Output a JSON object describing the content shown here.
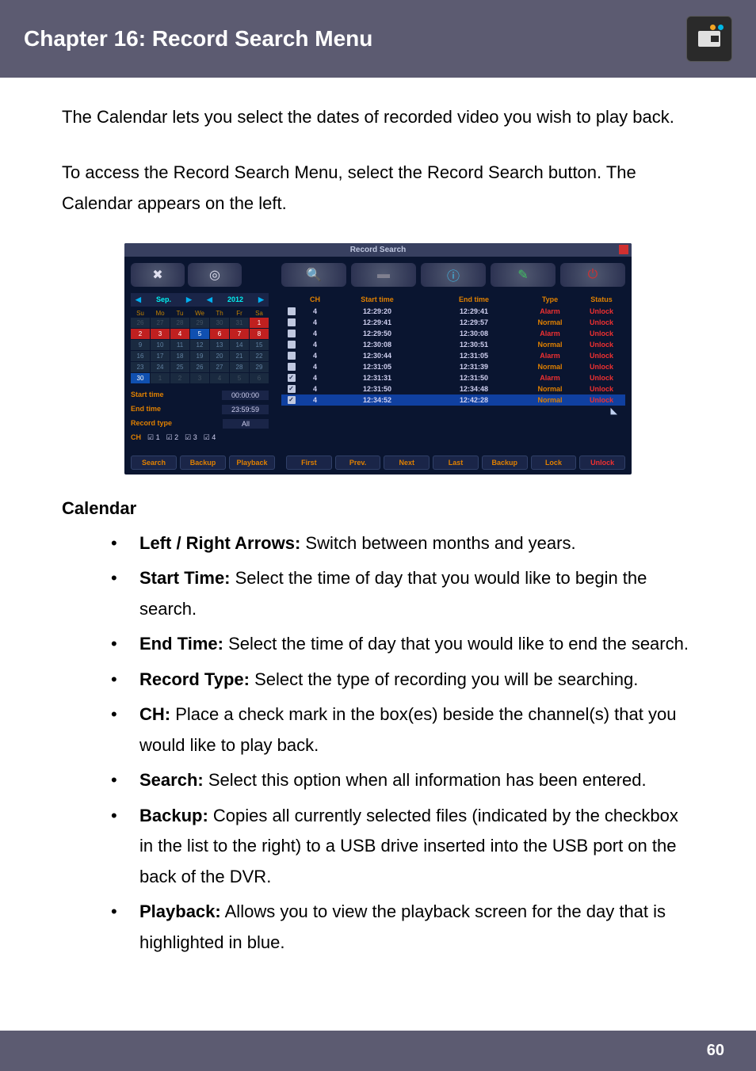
{
  "header": {
    "title": "Chapter 16: Record Search Menu"
  },
  "intro": {
    "p1": "The Calendar lets you select the dates of recorded video you wish to play back.",
    "p2": "To access the Record Search Menu, select the Record Search button. The Calendar appears on the left."
  },
  "screenshot": {
    "title": "Record Search",
    "month_row": {
      "month": "Sep.",
      "year": "2012"
    },
    "dow": [
      "Su",
      "Mo",
      "Tu",
      "We",
      "Th",
      "Fr",
      "Sa"
    ],
    "calendar_weeks": [
      [
        {
          "d": "26",
          "c": "dim"
        },
        {
          "d": "27",
          "c": "dim"
        },
        {
          "d": "28",
          "c": "dim"
        },
        {
          "d": "29",
          "c": "dim"
        },
        {
          "d": "30",
          "c": "dim"
        },
        {
          "d": "31",
          "c": "dim"
        },
        {
          "d": "1",
          "c": "red"
        }
      ],
      [
        {
          "d": "2",
          "c": "red"
        },
        {
          "d": "3",
          "c": "red"
        },
        {
          "d": "4",
          "c": "red"
        },
        {
          "d": "5",
          "c": "blue"
        },
        {
          "d": "6",
          "c": "red"
        },
        {
          "d": "7",
          "c": "red"
        },
        {
          "d": "8",
          "c": "red"
        }
      ],
      [
        {
          "d": "9",
          "c": ""
        },
        {
          "d": "10",
          "c": ""
        },
        {
          "d": "11",
          "c": ""
        },
        {
          "d": "12",
          "c": ""
        },
        {
          "d": "13",
          "c": ""
        },
        {
          "d": "14",
          "c": ""
        },
        {
          "d": "15",
          "c": ""
        }
      ],
      [
        {
          "d": "16",
          "c": ""
        },
        {
          "d": "17",
          "c": ""
        },
        {
          "d": "18",
          "c": ""
        },
        {
          "d": "19",
          "c": ""
        },
        {
          "d": "20",
          "c": ""
        },
        {
          "d": "21",
          "c": ""
        },
        {
          "d": "22",
          "c": ""
        }
      ],
      [
        {
          "d": "23",
          "c": ""
        },
        {
          "d": "24",
          "c": ""
        },
        {
          "d": "25",
          "c": ""
        },
        {
          "d": "26",
          "c": ""
        },
        {
          "d": "27",
          "c": ""
        },
        {
          "d": "28",
          "c": ""
        },
        {
          "d": "29",
          "c": ""
        }
      ],
      [
        {
          "d": "30",
          "c": "blue"
        },
        {
          "d": "1",
          "c": "dim"
        },
        {
          "d": "2",
          "c": "dim"
        },
        {
          "d": "3",
          "c": "dim"
        },
        {
          "d": "4",
          "c": "dim"
        },
        {
          "d": "5",
          "c": "dim"
        },
        {
          "d": "6",
          "c": "dim"
        }
      ]
    ],
    "fields": {
      "start_time_label": "Start time",
      "start_time_value": "00:00:00",
      "end_time_label": "End time",
      "end_time_value": "23:59:59",
      "record_type_label": "Record type",
      "record_type_value": "All",
      "ch_label": "CH",
      "ch_values": [
        "☑ 1",
        "☑ 2",
        "☑ 3",
        "☑ 4"
      ]
    },
    "table": {
      "headers": [
        "",
        "CH",
        "Start time",
        "End time",
        "Type",
        "Status"
      ],
      "rows": [
        {
          "cb": "☐",
          "ch": "4",
          "start": "12:29:20",
          "end": "12:29:41",
          "type": "Alarm",
          "type_class": "type-alarm",
          "status": "Unlock"
        },
        {
          "cb": "☐",
          "ch": "4",
          "start": "12:29:41",
          "end": "12:29:57",
          "type": "Normal",
          "type_class": "type-normal",
          "status": "Unlock"
        },
        {
          "cb": "☐",
          "ch": "4",
          "start": "12:29:50",
          "end": "12:30:08",
          "type": "Alarm",
          "type_class": "type-alarm",
          "status": "Unlock"
        },
        {
          "cb": "☐",
          "ch": "4",
          "start": "12:30:08",
          "end": "12:30:51",
          "type": "Normal",
          "type_class": "type-normal",
          "status": "Unlock"
        },
        {
          "cb": "☐",
          "ch": "4",
          "start": "12:30:44",
          "end": "12:31:05",
          "type": "Alarm",
          "type_class": "type-alarm",
          "status": "Unlock"
        },
        {
          "cb": "☐",
          "ch": "4",
          "start": "12:31:05",
          "end": "12:31:39",
          "type": "Normal",
          "type_class": "type-normal",
          "status": "Unlock"
        },
        {
          "cb": "☑",
          "ch": "4",
          "start": "12:31:31",
          "end": "12:31:50",
          "type": "Alarm",
          "type_class": "type-alarm",
          "status": "Unlock"
        },
        {
          "cb": "☑",
          "ch": "4",
          "start": "12:31:50",
          "end": "12:34:48",
          "type": "Normal",
          "type_class": "type-normal",
          "status": "Unlock"
        },
        {
          "cb": "☑",
          "ch": "4",
          "start": "12:34:52",
          "end": "12:42:28",
          "type": "Normal",
          "type_class": "type-normal",
          "status": "Unlock",
          "sel": true
        }
      ]
    },
    "left_buttons": [
      "Search",
      "Backup",
      "Playback"
    ],
    "right_buttons": [
      "First",
      "Prev.",
      "Next",
      "Last",
      "Backup",
      "Lock",
      "Unlock"
    ]
  },
  "section_title": "Calendar",
  "bullets": [
    {
      "label": "Left / Right Arrows:",
      "text": " Switch between months and years."
    },
    {
      "label": "Start Time:",
      "text": " Select the time of day that you would like to begin the search."
    },
    {
      "label": "End Time:",
      "text": " Select the time of day that you would like to end the search."
    },
    {
      "label": "Record Type:",
      "text": " Select the type of recording you will be searching."
    },
    {
      "label": "CH:",
      "text": " Place a check mark in the box(es) beside the channel(s) that you would like to play back."
    },
    {
      "label": "Search:",
      "text": " Select this option when all information has been entered."
    },
    {
      "label": "Backup:",
      "text": " Copies all currently selected files (indicated by the checkbox in the list to the right) to a USB drive inserted into the USB port on the back of the DVR."
    },
    {
      "label": "Playback:",
      "text": " Allows you to view the playback screen for the day that is highlighted in blue."
    }
  ],
  "footer": {
    "page": "60"
  }
}
